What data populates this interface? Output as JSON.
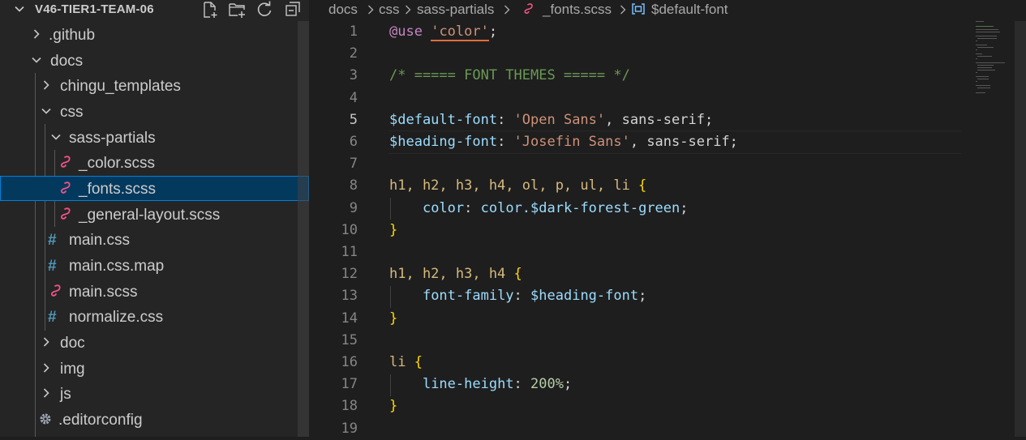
{
  "sidebar": {
    "title": "V46-TIER1-TEAM-06",
    "header_actions": [
      "new-file-icon",
      "new-folder-icon",
      "refresh-icon",
      "collapse-all-icon"
    ],
    "tree": [
      {
        "label": ".github",
        "kind": "folder",
        "expanded": false
      },
      {
        "label": "docs",
        "kind": "folder",
        "expanded": true
      },
      {
        "label": "chingu_templates",
        "kind": "folder",
        "expanded": false
      },
      {
        "label": "css",
        "kind": "folder",
        "expanded": true
      },
      {
        "label": "sass-partials",
        "kind": "folder",
        "expanded": true
      },
      {
        "label": "_color.scss",
        "kind": "sass"
      },
      {
        "label": "_fonts.scss",
        "kind": "sass",
        "selected": true
      },
      {
        "label": "_general-layout.scss",
        "kind": "sass"
      },
      {
        "label": "main.css",
        "kind": "css"
      },
      {
        "label": "main.css.map",
        "kind": "css"
      },
      {
        "label": "main.scss",
        "kind": "sass"
      },
      {
        "label": "normalize.css",
        "kind": "css"
      },
      {
        "label": "doc",
        "kind": "folder",
        "expanded": false
      },
      {
        "label": "img",
        "kind": "folder",
        "expanded": false
      },
      {
        "label": "js",
        "kind": "folder",
        "expanded": false
      },
      {
        "label": ".editorconfig",
        "kind": "config"
      }
    ]
  },
  "breadcrumb": {
    "items": [
      "docs",
      "css",
      "sass-partials",
      "_fonts.scss",
      "$default-font"
    ]
  },
  "editor": {
    "active_line": "5",
    "lines": [
      {
        "n": "1",
        "parts": [
          {
            "c": "t-key",
            "t": "@use"
          },
          {
            "c": "t-pun",
            "t": " "
          },
          {
            "c": "t-str squig",
            "t": "'color'"
          },
          {
            "c": "t-pun",
            "t": ";"
          }
        ]
      },
      {
        "n": "2",
        "parts": []
      },
      {
        "n": "3",
        "parts": [
          {
            "c": "t-com",
            "t": "/* ===== FONT THEMES ===== */"
          }
        ]
      },
      {
        "n": "4",
        "parts": []
      },
      {
        "n": "5",
        "parts": [
          {
            "c": "t-var",
            "t": "$default-font"
          },
          {
            "c": "t-pun",
            "t": ": "
          },
          {
            "c": "t-str",
            "t": "'Open Sans'"
          },
          {
            "c": "t-pun",
            "t": ", sans-serif;"
          }
        ]
      },
      {
        "n": "6",
        "parts": [
          {
            "c": "t-var",
            "t": "$heading-font"
          },
          {
            "c": "t-pun",
            "t": ": "
          },
          {
            "c": "t-str",
            "t": "'Josefin Sans'"
          },
          {
            "c": "t-pun",
            "t": ", sans-serif;"
          }
        ]
      },
      {
        "n": "7",
        "parts": []
      },
      {
        "n": "8",
        "parts": [
          {
            "c": "t-sel",
            "t": "h1, h2, h3, h4, ol, p, ul, li "
          },
          {
            "c": "t-br",
            "t": "{"
          }
        ]
      },
      {
        "n": "9",
        "parts": [
          {
            "c": "t-pun",
            "t": "    "
          },
          {
            "c": "t-var",
            "t": "color"
          },
          {
            "c": "t-pun",
            "t": ": "
          },
          {
            "c": "t-fn",
            "t": "color.$dark-forest-green"
          },
          {
            "c": "t-pun",
            "t": ";"
          }
        ]
      },
      {
        "n": "10",
        "parts": [
          {
            "c": "t-br",
            "t": "}"
          }
        ]
      },
      {
        "n": "11",
        "parts": []
      },
      {
        "n": "12",
        "parts": [
          {
            "c": "t-sel",
            "t": "h1, h2, h3, h4 "
          },
          {
            "c": "t-br",
            "t": "{"
          }
        ]
      },
      {
        "n": "13",
        "parts": [
          {
            "c": "t-pun",
            "t": "    "
          },
          {
            "c": "t-var",
            "t": "font-family"
          },
          {
            "c": "t-pun",
            "t": ": "
          },
          {
            "c": "t-var",
            "t": "$heading-font"
          },
          {
            "c": "t-pun",
            "t": ";"
          }
        ]
      },
      {
        "n": "14",
        "parts": [
          {
            "c": "t-br",
            "t": "}"
          }
        ]
      },
      {
        "n": "15",
        "parts": []
      },
      {
        "n": "16",
        "parts": [
          {
            "c": "t-sel",
            "t": "li "
          },
          {
            "c": "t-br",
            "t": "{"
          }
        ]
      },
      {
        "n": "17",
        "parts": [
          {
            "c": "t-pun",
            "t": "    "
          },
          {
            "c": "t-var",
            "t": "line-height"
          },
          {
            "c": "t-pun",
            "t": ": "
          },
          {
            "c": "t-num",
            "t": "200%"
          },
          {
            "c": "t-pun",
            "t": ";"
          }
        ]
      },
      {
        "n": "18",
        "parts": [
          {
            "c": "t-br",
            "t": "}"
          }
        ]
      },
      {
        "n": "19",
        "parts": []
      }
    ]
  },
  "colors": {
    "sidebar_bg": "#252526",
    "editor_bg": "#1e1e1e",
    "selection": "#04395e",
    "sass_icon": "#f55385",
    "css_icon": "#519aba",
    "symbol_icon": "#75beff"
  }
}
